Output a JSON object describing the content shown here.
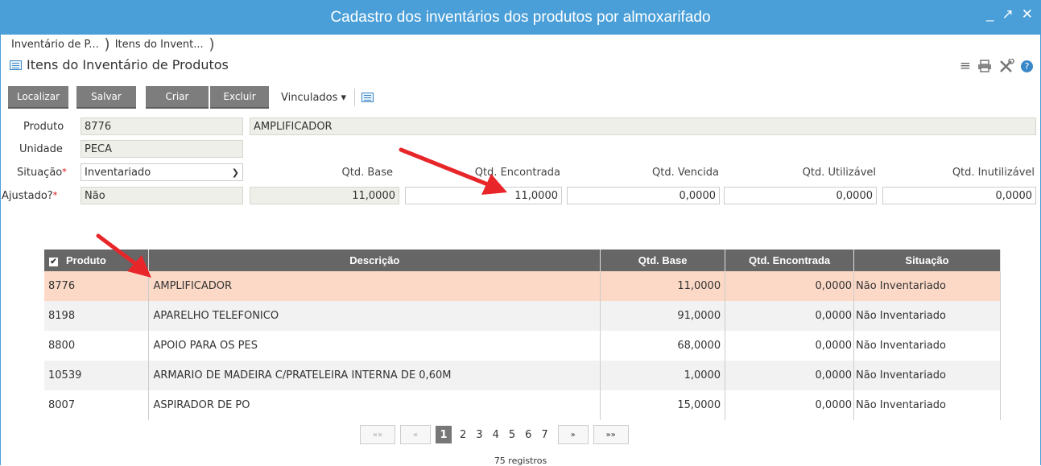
{
  "window": {
    "title": "Cadastro dos inventários dos produtos por almoxarifado",
    "controls": [
      "_",
      "↗",
      "✕"
    ]
  },
  "breadcrumbs": [
    "Inventário de P...",
    "Itens do Invent..."
  ],
  "form": {
    "title": "Itens do Inventário de Produtos"
  },
  "toolbar": {
    "localizar": "Localizar",
    "salvar": "Salvar",
    "criar": "Criar",
    "excluir": "Excluir",
    "vinculados": "Vinculados ▾"
  },
  "fields": {
    "produto_label": "Produto",
    "produto_code": "8776",
    "produto_desc": "AMPLIFICADOR",
    "unidade_label": "Unidade",
    "unidade_value": "PECA",
    "situacao_label": "Situação",
    "situacao_value": "Inventariado",
    "ajustado_label": "Ajustado?",
    "ajustado_value": "Não",
    "qtd_base_label": "Qtd. Base",
    "qtd_base_value": "11,0000",
    "qtd_encontrada_label": "Qtd. Encontrada",
    "qtd_encontrada_value": "11,0000",
    "qtd_vencida_label": "Qtd. Vencida",
    "qtd_vencida_value": "0,0000",
    "qtd_utilizavel_label": "Qtd. Utilizável",
    "qtd_utilizavel_value": "0,0000",
    "qtd_inutilizavel_label": "Qtd. Inutilizável",
    "qtd_inutilizavel_value": "0,0000"
  },
  "grid": {
    "columns": [
      "Produto",
      "Descrição",
      "Qtd. Base",
      "Qtd. Encontrada",
      "Situação"
    ],
    "rows": [
      [
        "8776",
        "AMPLIFICADOR",
        "11,0000",
        "0,0000",
        "Não Inventariado"
      ],
      [
        "8198",
        "APARELHO TELEFONICO",
        "91,0000",
        "0,0000",
        "Não Inventariado"
      ],
      [
        "8800",
        "APOIO PARA OS PES",
        "68,0000",
        "0,0000",
        "Não Inventariado"
      ],
      [
        "10539",
        "ARMARIO DE MADEIRA C/PRATELEIRA INTERNA DE 0,60M",
        "1,0000",
        "0,0000",
        "Não Inventariado"
      ],
      [
        "8007",
        "ASPIRADOR DE PO",
        "15,0000",
        "0,0000",
        "Não Inventariado"
      ]
    ]
  },
  "pager": {
    "first": "««",
    "prev": "«",
    "pages": [
      "1",
      "2",
      "3",
      "4",
      "5",
      "6",
      "7"
    ],
    "current": "1",
    "next": "»",
    "last": "»»",
    "count": "75 registros"
  },
  "colors": {
    "titlebar": "#4a9fd8",
    "button": "#7d7d7d",
    "selected_row": "#fcd9c6",
    "arrow": "#e8262a"
  }
}
